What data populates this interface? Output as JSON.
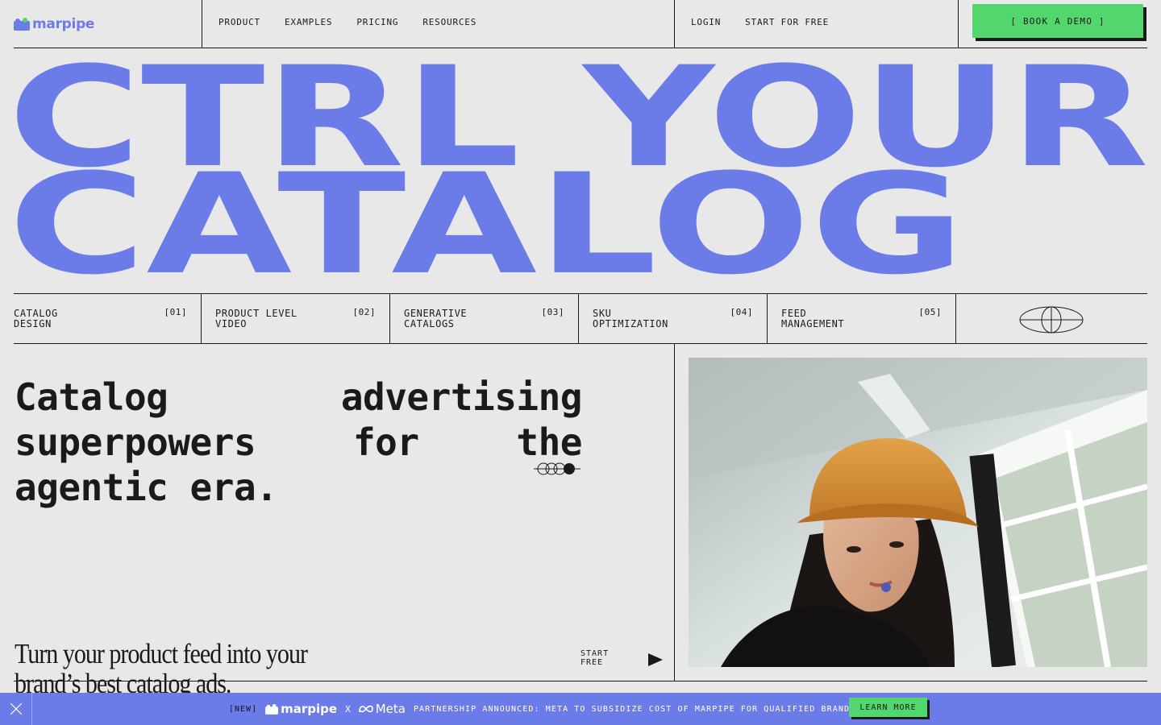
{
  "nav": {
    "logo_text": "marpipe",
    "links": [
      "PRODUCT",
      "EXAMPLES",
      "PRICING",
      "RESOURCES"
    ],
    "login": "LOGIN",
    "start_free": "START FOR FREE",
    "book_demo": "[ BOOK A DEMO ]"
  },
  "hero": {
    "line1": "CTRL YOUR",
    "line2": "CATALOG",
    "color": "#6b7be8"
  },
  "features": [
    {
      "label": "CATALOG\nDESIGN",
      "num": "[01]"
    },
    {
      "label": "PRODUCT LEVEL\nVIDEO",
      "num": "[02]"
    },
    {
      "label": "GENERATIVE\nCATALOGS",
      "num": "[03]"
    },
    {
      "label": "SKU\nOPTIMIZATION",
      "num": "[04]"
    },
    {
      "label": "FEED\nMANAGEMENT",
      "num": "[05]"
    }
  ],
  "main": {
    "headline": "Catalog advertising superpowers for the agentic era.",
    "subtitle": "Turn your product feed into your brand’s best catalog ads.",
    "start_free": "START\nFREE"
  },
  "banner": {
    "new_tag": "[NEW]",
    "logo_text": "marpipe",
    "x": "X",
    "meta_text": "Meta",
    "message": "PARTNERSHIP ANNOUNCED: META TO SUBSIDIZE COST OF MARPIPE FOR QUALIFIED BRANDS.",
    "learn_more": "LEARN MORE"
  },
  "colors": {
    "accent": "#6b7be8",
    "cta": "#52d66e",
    "background": "#e8e8e8",
    "ink": "#1a1a1a"
  }
}
